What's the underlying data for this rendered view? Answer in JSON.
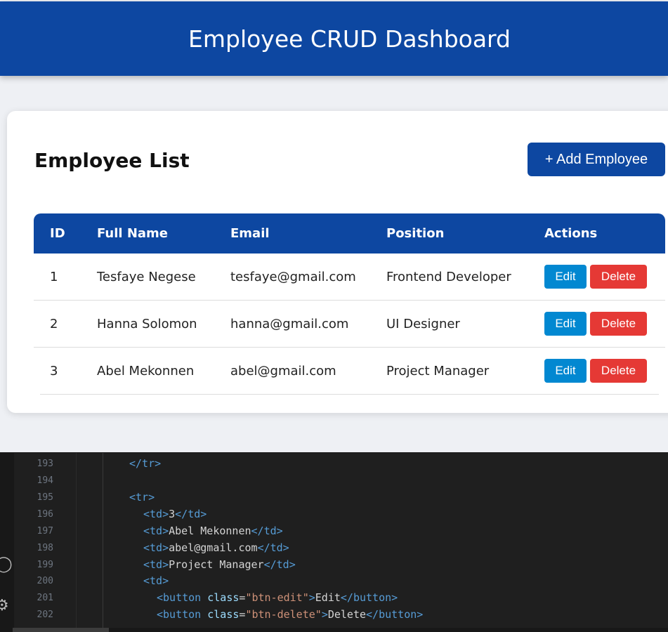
{
  "header": {
    "title": "Employee CRUD Dashboard"
  },
  "card": {
    "title": "Employee List",
    "add_button": "+ Add Employee"
  },
  "table": {
    "columns": [
      "ID",
      "Full Name",
      "Email",
      "Position",
      "Actions"
    ],
    "rows": [
      {
        "id": "1",
        "name": "Tesfaye Negese",
        "email": "tesfaye@gmail.com",
        "position": "Frontend Developer",
        "edit": "Edit",
        "delete": "Delete"
      },
      {
        "id": "2",
        "name": "Hanna Solomon",
        "email": "hanna@gmail.com",
        "position": "UI Designer",
        "edit": "Edit",
        "delete": "Delete"
      },
      {
        "id": "3",
        "name": "Abel Mekonnen",
        "email": "abel@gmail.com",
        "position": "Project Manager",
        "edit": "Edit",
        "delete": "Delete"
      }
    ]
  },
  "editor": {
    "line_numbers": [
      "193",
      "194",
      "195",
      "196",
      "197",
      "198",
      "199",
      "200",
      "201",
      "202"
    ],
    "lines": {
      "l193": {
        "close_tr": "</tr>"
      },
      "l195": {
        "open_tr": "<tr>"
      },
      "l196": {
        "open": "<td>",
        "text": "3",
        "close": "</td>"
      },
      "l197": {
        "open": "<td>",
        "text": "Abel Mekonnen",
        "close": "</td>"
      },
      "l198": {
        "open": "<td>",
        "text": "abel@gmail.com",
        "close": "</td>"
      },
      "l199": {
        "open": "<td>",
        "text": "Project Manager",
        "close": "</td>"
      },
      "l200": {
        "open": "<td>"
      },
      "l201": {
        "open": "<button",
        "attr": "class",
        "eq": "=",
        "value": "\"btn-edit\"",
        "gt": ">",
        "text": "Edit",
        "close": "</button>"
      },
      "l202": {
        "open": "<button",
        "attr": "class",
        "eq": "=",
        "value": "\"btn-delete\"",
        "gt": ">",
        "text": "Delete",
        "close": "</button>"
      }
    }
  },
  "colors": {
    "primary": "#0d47a1",
    "edit": "#0288d1",
    "delete": "#e53935",
    "page_bg": "#eef0f4",
    "editor_bg": "#1f1f1f"
  },
  "icons": [
    "account-icon",
    "settings-icon"
  ]
}
